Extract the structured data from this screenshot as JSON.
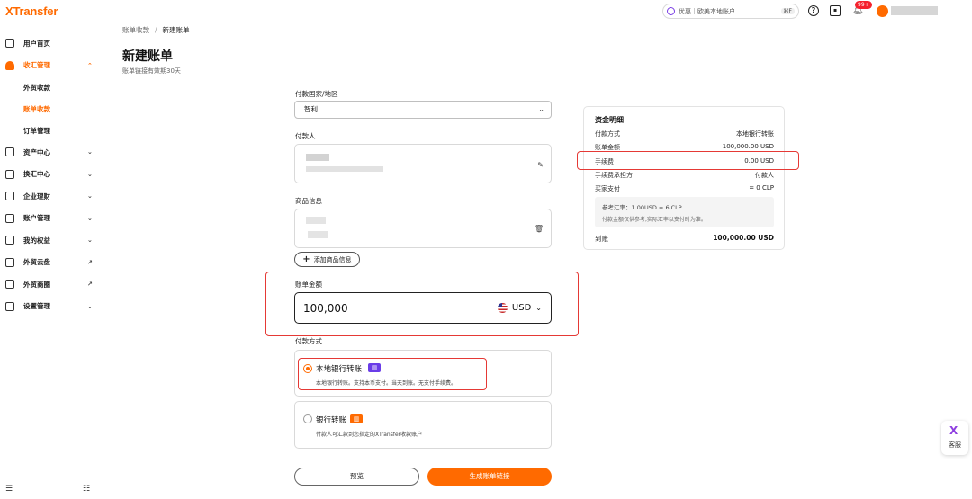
{
  "brand": {
    "logo_x": "X",
    "logo_rest": "Transfer"
  },
  "header": {
    "search_placeholder": "优惠｜欧美本地账户",
    "search_shortcut": "⌘F",
    "notification_badge": "99+"
  },
  "sidebar": {
    "items": [
      {
        "label": "用户首页",
        "chevron": ""
      },
      {
        "label": "收汇管理",
        "chevron": "⌃"
      },
      {
        "label": "资产中心",
        "chevron": "⌄"
      },
      {
        "label": "换汇中心",
        "chevron": "⌄"
      },
      {
        "label": "企业理财",
        "chevron": "⌄"
      },
      {
        "label": "账户管理",
        "chevron": "⌄"
      },
      {
        "label": "我的权益",
        "chevron": "⌄"
      },
      {
        "label": "外贸云盘",
        "chevron": "↗"
      },
      {
        "label": "外贸商圈",
        "chevron": "↗"
      },
      {
        "label": "设置管理",
        "chevron": "⌄"
      }
    ],
    "subitems": [
      "外贸收款",
      "账单收款",
      "订单管理"
    ]
  },
  "breadcrumb": {
    "parent": "账单收款",
    "sep": "/",
    "current": "新建账单"
  },
  "page": {
    "title": "新建账单",
    "subtitle": "账单链接有效期30天"
  },
  "form": {
    "country_label": "付款国家/地区",
    "country_value": "智利",
    "payer_label": "付款人",
    "goods_label": "商品信息",
    "add_goods_label": "添加商品信息",
    "amount_label": "账单金额",
    "amount_value": "100,000",
    "currency": "USD",
    "method_label": "付款方式",
    "methods": [
      {
        "title": "本地银行转账",
        "desc": "本地银行转账。支持本币支付。当天到账。无支付手续费。",
        "tag_color": "#6a3de8"
      },
      {
        "title": "银行转账",
        "desc": "付款人可汇款到您指定的XTransfer收款账户",
        "tag_color": "#ff6a00"
      }
    ],
    "preview_label": "预览",
    "generate_label": "生成账单链接"
  },
  "summary": {
    "title": "资金明细",
    "rows": [
      {
        "k": "付款方式",
        "v": "本地银行转账"
      },
      {
        "k": "账单金额",
        "v": "100,000.00 USD"
      },
      {
        "k": "手续费",
        "v": "0.00 USD"
      },
      {
        "k": "手续费承担方",
        "v": "付款人"
      },
      {
        "k": "买家支付",
        "v": "=                0 CLP"
      }
    ],
    "rate_line": "参考汇率：1.00USD =               6 CLP",
    "rate_note": "付款金额仅供参考,实际汇率以支付时为准。",
    "total_label": "到账",
    "total_value": "100,000.00 USD"
  },
  "support": {
    "label": "客服",
    "icon": "X"
  },
  "colors": {
    "accent": "#ff6a00",
    "highlight": "#e53935"
  }
}
